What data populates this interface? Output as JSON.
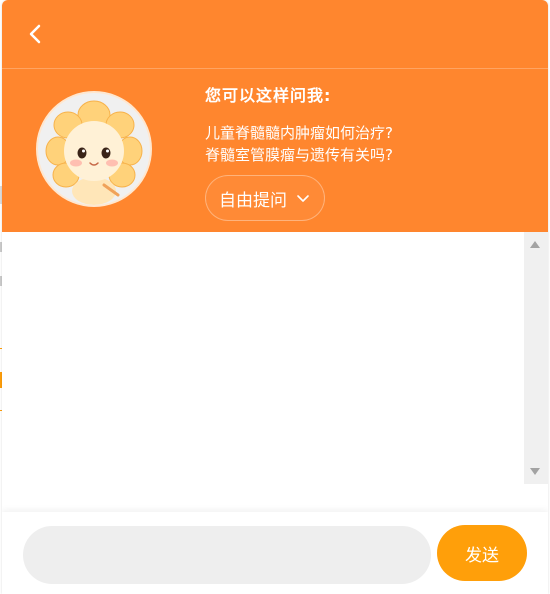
{
  "header": {
    "back_icon": "chevron-left-icon",
    "suggest_title": "您可以这样问我:",
    "suggestions": [
      "儿童脊髓髓内肿瘤如何治疗?",
      "脊髓室管膜瘤与遗传有关吗?"
    ],
    "mode_button": {
      "label": "自由提问",
      "icon": "chevron-down-icon"
    },
    "avatar": "sunflower-mascot-avatar"
  },
  "composer": {
    "placeholder": "",
    "value": "",
    "send_label": "发送"
  },
  "colors": {
    "header_bg": "#ff862e",
    "send_bg": "#ff9f0a",
    "input_bg": "#eeeeee"
  }
}
